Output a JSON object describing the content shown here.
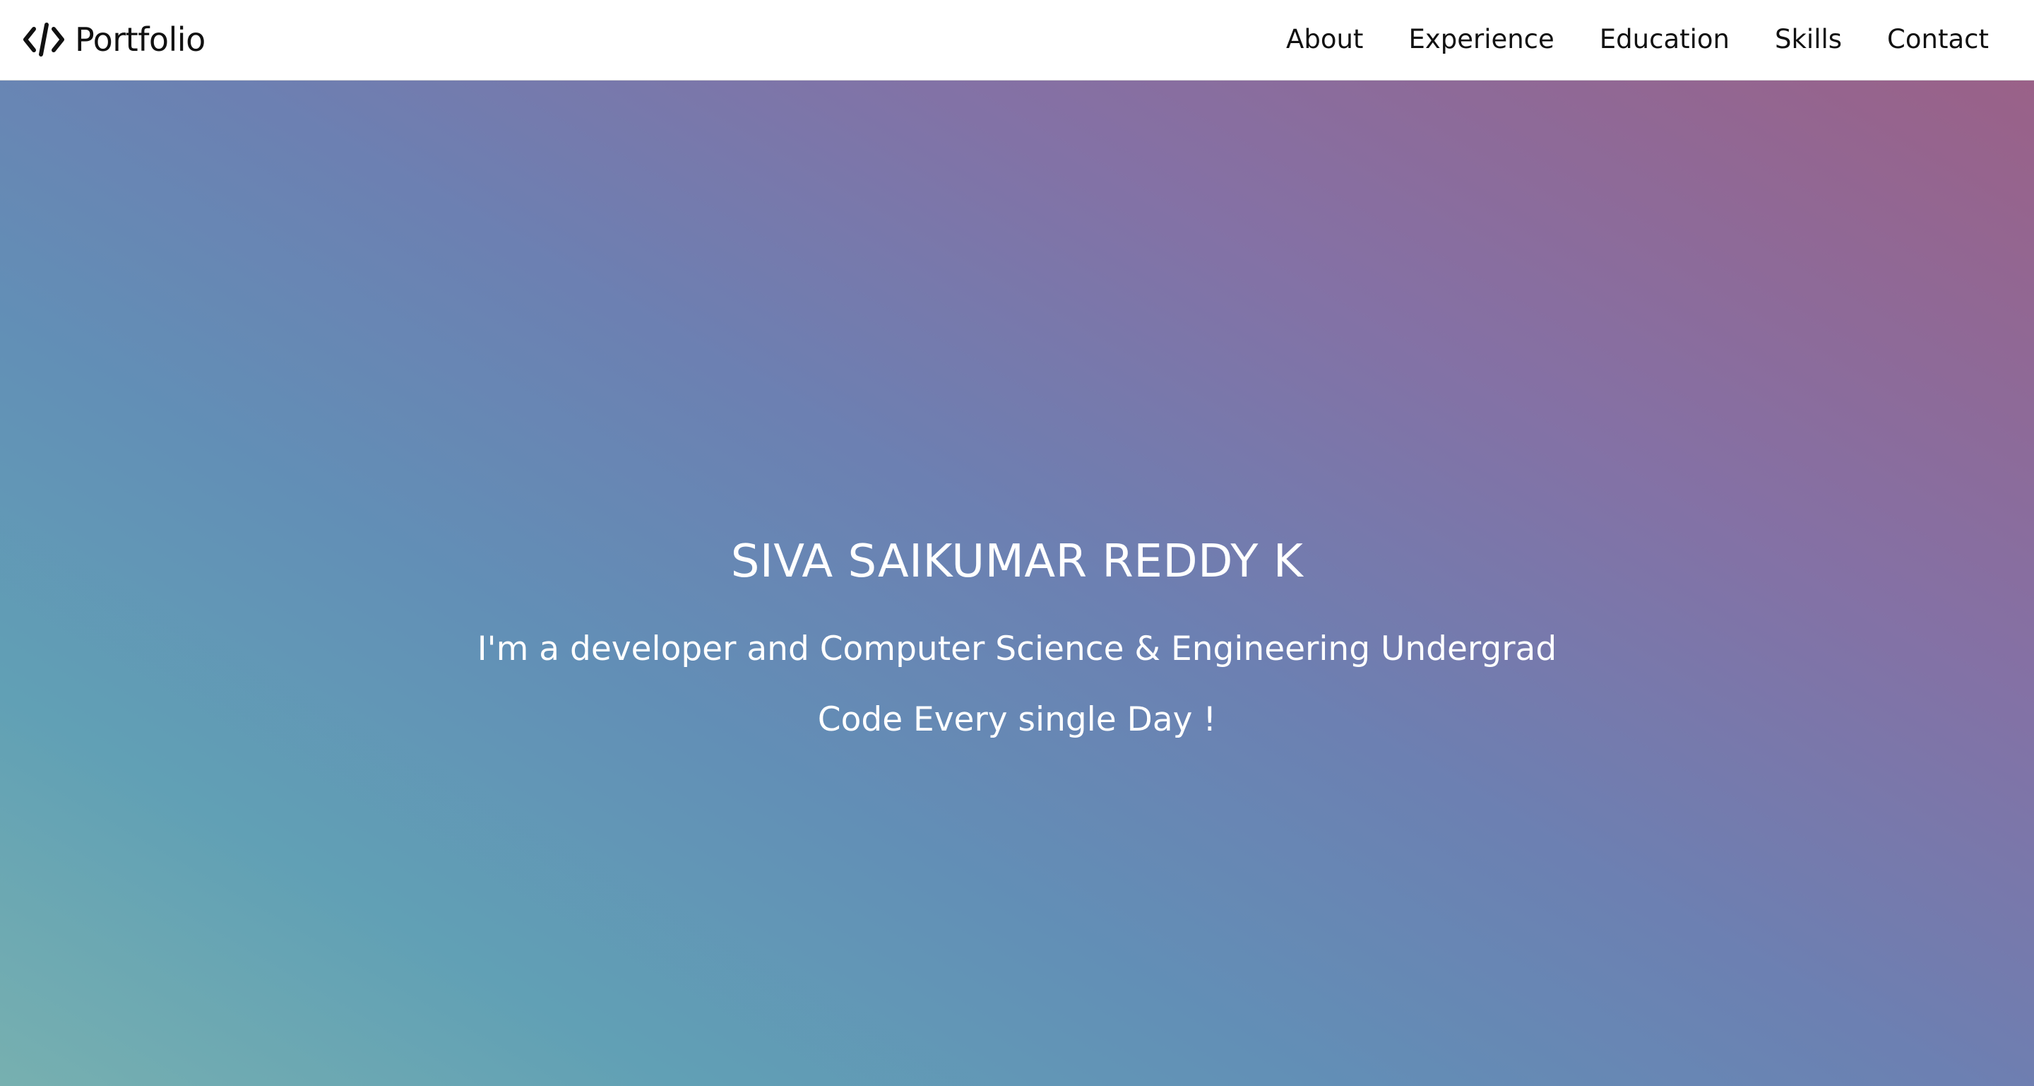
{
  "navbar": {
    "brand_label": "Portfolio",
    "brand_icon": "code-icon",
    "links": [
      {
        "label": "About"
      },
      {
        "label": "Experience"
      },
      {
        "label": "Education"
      },
      {
        "label": "Skills"
      },
      {
        "label": "Contact"
      }
    ]
  },
  "hero": {
    "name": "SIVA SAIKUMAR REDDY K",
    "subtitle": "I'm a developer and Computer Science & Engineering Undergrad",
    "tagline": "Code Every single Day !"
  },
  "colors": {
    "gradient_start": "#77b0b0",
    "gradient_mid": "#6c80b2",
    "gradient_end": "#9a6188",
    "text_on_hero": "#ffffff",
    "nav_text": "#111111"
  }
}
